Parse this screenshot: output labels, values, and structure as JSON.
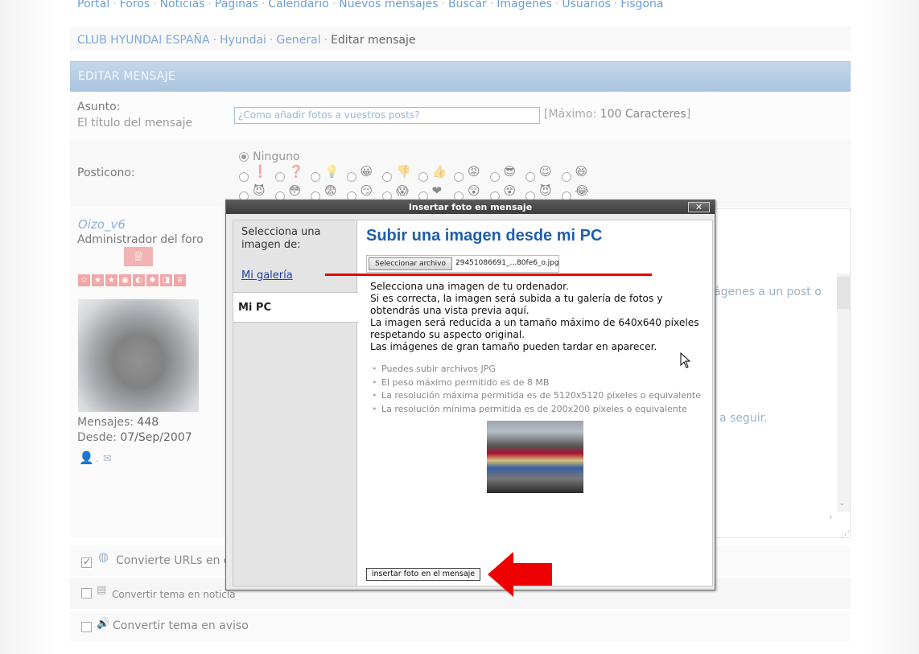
{
  "nav": {
    "links": [
      "Portal",
      "Foros",
      "Noticias",
      "Páginas",
      "Calendario",
      "Nuevos mensajes",
      "Buscar",
      "Imágenes",
      "Usuarios",
      "Fisgona"
    ],
    "separator": "·"
  },
  "breadcrumb": {
    "items": [
      "CLUB HYUNDAI ESPAÑA",
      "Hyundai",
      "General"
    ],
    "current": "Editar mensaje"
  },
  "section": {
    "title": "EDITAR MENSAJE"
  },
  "subject": {
    "label": "Asunto:",
    "sublabel": "El título del mensaje",
    "value": "¿Como añadir fotos a vuestros posts?",
    "max_prefix": "[Máximo:",
    "max_value": "100 Caracteres",
    "max_suffix": "]"
  },
  "posticon": {
    "label": "Posticono:",
    "none_label": "Ninguno",
    "row1": [
      "❗",
      "❓",
      "💡",
      "😀",
      "👎",
      "👍",
      "😡",
      "😎",
      "😉",
      "😆"
    ],
    "row2": [
      "😈",
      "😳",
      "😨",
      "😏",
      "😱",
      "❤",
      "😲",
      "😵",
      "😈",
      "😂"
    ]
  },
  "user": {
    "name": "Oizo_v6",
    "title": "Administrador del foro",
    "rank_icon": "trophy-icon",
    "stars": [
      "☆",
      "★",
      "★",
      "◉",
      "◐",
      "✹",
      "◨",
      "♕"
    ],
    "posts_label": "Mensajes:",
    "posts_value": "448",
    "since_label": "Desde:",
    "since_value": "07/Sep/2007",
    "dot": "."
  },
  "editor": {
    "text_fragment_1": "ágenes a un post o",
    "text_fragment_2": "a seguir."
  },
  "options": [
    {
      "label": "Convierte URLs en en",
      "checked": true,
      "icon": "link-globe-icon"
    },
    {
      "label": "Convertir tema en noticia",
      "checked": false,
      "icon": "news-icon"
    },
    {
      "label": "Convertir tema en aviso",
      "checked": false,
      "icon": "speaker-icon"
    }
  ],
  "dialog": {
    "title": "Insertar foto en mensaje",
    "close_label": "✕",
    "side_label": "Selecciona una imagen de:",
    "side_link": "Mi galería",
    "side_active": "Mi PC",
    "main_title": "Subir una imagen desde mi PC",
    "file_button": "Seleccionar archivo",
    "file_name": "29451086691_...80fe6_o.jpg",
    "desc_lines": [
      "Selecciona una imagen de tu ordenador.",
      "Si es correcta, la imagen será subida a tu galería de fotos y obtendrás una vista previa aquí.",
      "La imagen será reducida a un tamaño máximo de 640x640 píxeles respetando su aspecto original.",
      "Las imágenes de gran tamaño pueden tardar en aparecer."
    ],
    "bullets": [
      "Puedes subir archivos JPG",
      "El peso máximo permitido es de 8 MB",
      "La resolución máxima permitida es de 5120x5120 píxeles o equivalente",
      "La resolución mínima permitida es de 200x200 píxeles o equivalente"
    ],
    "insert_button": "insertar foto en el mensaje"
  },
  "colors": {
    "link": "#6a9ed6",
    "header_bg": "#a9c5df",
    "dialog_title": "#1f5fae",
    "annotation_red": "#e00000"
  }
}
